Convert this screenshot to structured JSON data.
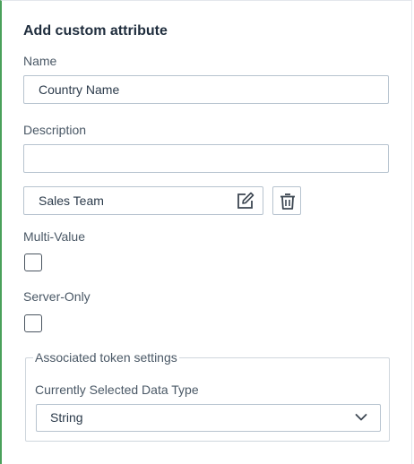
{
  "title": "Add custom attribute",
  "name": {
    "label": "Name",
    "value": "Country Name"
  },
  "description": {
    "label": "Description",
    "value": ""
  },
  "entity": {
    "value": "Sales Team",
    "edit_icon": "edit-icon",
    "delete_icon": "trash-icon"
  },
  "multi_value": {
    "label": "Multi-Value",
    "checked": false
  },
  "server_only": {
    "label": "Server-Only",
    "checked": false
  },
  "token_settings": {
    "legend": "Associated token settings",
    "data_type_label": "Currently Selected Data Type",
    "data_type_value": "String",
    "chevron_icon": "chevron-down-icon"
  }
}
